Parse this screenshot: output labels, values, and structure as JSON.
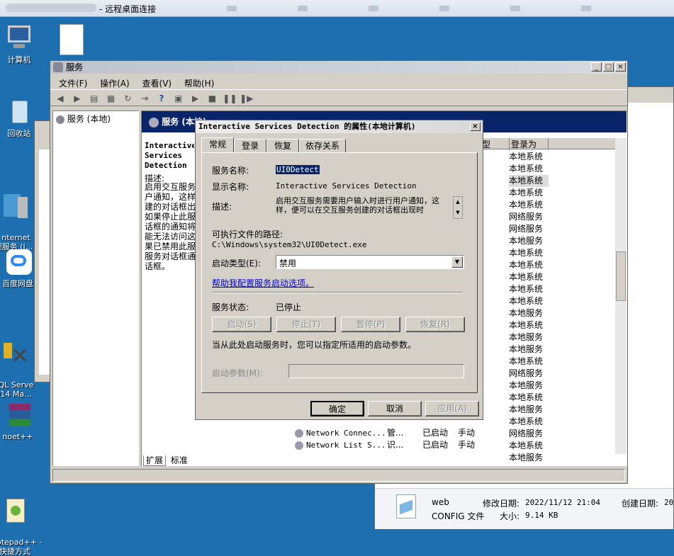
{
  "rdp": {
    "title": "- 远程桌面连接"
  },
  "desktop": {
    "icons": [
      {
        "label": "计算机"
      },
      {
        "label": "回收站"
      },
      {
        "label": "nternet\n理服务 (I..."
      },
      {
        "label": "百度网盘"
      },
      {
        "label": "QL Serve\n014 Ma..."
      },
      {
        "label": "noet++"
      },
      {
        "label": "otepad++ -\n快捷方式"
      }
    ]
  },
  "services_window": {
    "title": "服务",
    "menu": [
      "文件(F)",
      "操作(A)",
      "查看(V)",
      "帮助(H)"
    ],
    "tree_item": "服务 (本地)",
    "header": "服务 (本地)",
    "desc_title": "Interactive Services Detection",
    "desc_label": "描述:",
    "desc_text": "启用交互服务户通知，这样建的对话框出如果停止此服话框的通知将能无法访问这果已禁用此服服务对话框通话框。",
    "columns": {
      "type": "型",
      "logon": "登录为"
    },
    "logon_as": [
      "本地系统",
      "本地系统",
      "本地系统",
      "本地系统",
      "本地系统",
      "网络服务",
      "网络服务",
      "本地服务",
      "本地系统",
      "本地系统",
      "本地系统",
      "本地系统",
      "本地系统",
      "本地服务",
      "本地系统",
      "本地服务",
      "本地服务",
      "本地系统",
      "网络服务",
      "本地服务",
      "本地系统",
      "本地服务",
      "本地系统",
      "网络服务",
      "本地系统",
      "本地服务"
    ],
    "visible_rows": [
      {
        "name": "Network Connec...",
        "desc": "管...",
        "status": "已启动",
        "start": "手动",
        "logon": "本地系统"
      },
      {
        "name": "Network List S...",
        "desc": "识...",
        "status": "已启动",
        "start": "手动",
        "logon": "本地服务"
      }
    ],
    "tabs": [
      "扩展",
      "标准"
    ]
  },
  "dialog": {
    "title": "Interactive Services Detection 的属性(本地计算机)",
    "tabs": [
      "常规",
      "登录",
      "恢复",
      "依存关系"
    ],
    "service_name_label": "服务名称:",
    "service_name": "UI0Detect",
    "display_name_label": "显示名称:",
    "display_name": "Interactive Services Detection",
    "description_label": "描述:",
    "description": "启用交互服务需要用户输入时进行用户通知，这样，便可以在交互服务创建的对话框出现时",
    "path_label": "可执行文件的路径:",
    "path": "C:\\Windows\\system32\\UI0Detect.exe",
    "startup_type_label": "启动类型(E):",
    "startup_type": "禁用",
    "help_link": "帮助我配置服务启动选项。",
    "status_label": "服务状态:",
    "status": "已停止",
    "buttons": {
      "start": "启动(S)",
      "stop": "停止(T)",
      "pause": "暂停(P)",
      "resume": "恢复(R)"
    },
    "params_hint": "当从此处启动服务时，您可以指定所适用的启动参数。",
    "params_label": "启动参数(M):",
    "params_value": "",
    "ok": "确定",
    "cancel": "取消",
    "apply": "应用(A)"
  },
  "explorer_bottom": {
    "file_name": "web",
    "file_type": "CONFIG 文件",
    "modified_label": "修改日期:",
    "modified": "2022/11/12 21:04",
    "size_label": "大小:",
    "size": "9.14 KB",
    "created_label": "创建日期:",
    "created": "202"
  }
}
